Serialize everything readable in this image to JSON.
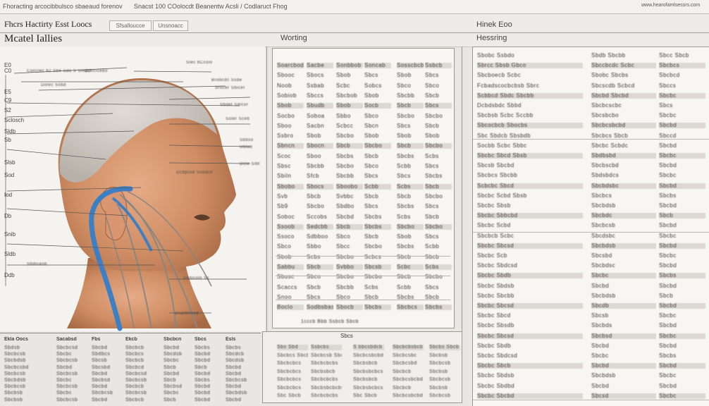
{
  "header": {
    "left_text": "Fhoracting arcocibbulsco sbaeaud forenov",
    "center_text": "Snacst 100 COolocdt Beanentw Acsli / Codlaruct Fhog",
    "right_text": "www.hearofamlsessrs.com"
  },
  "subheader": {
    "title": "Fhcrs Hactirty Esst  Loocs",
    "tabs": [
      "Sfsalloucce",
      "Unsnoacc"
    ],
    "right_label": "Hinek Eoo"
  },
  "diagram_panel": {
    "title": "Mcatel Iallies",
    "left_labels": [
      "E0",
      "C0",
      "E5",
      "C9",
      "S2",
      "Sclosch",
      "Sldb",
      "Sb",
      "Slsb",
      "Sod",
      "Iod",
      "Db",
      "Snib",
      "Sldb",
      "Ddb"
    ],
    "callouts": [
      "Conclec b2 Sbe Sdo S Sleacl",
      "Dolec Sobd",
      "Doncicebo",
      "Slec bCcoio",
      "Brobcdc Ssde",
      "Srocer Sbicer",
      "Sbdet Sdicor",
      "Soler Sceb",
      "Sbbso",
      "Ubteb",
      "Dcte Slbt",
      "Dcbpcse Scbdcn",
      "Sbdsiasb",
      "Dsdicolo Sc",
      "Dcalmccod"
    ]
  },
  "working_panel": {
    "title": "Worting",
    "columns": [
      [
        "Soarcbodbo",
        "Sbooc",
        "Noob",
        "Sobiob",
        "Sbob",
        "Socbo",
        "Sboo",
        "Ssbro",
        "Sbncn",
        "Scoc",
        "Sbsc",
        "Sbiln",
        "Sbobo",
        "Svb",
        "Sb9",
        "Soboc",
        "Ssoob",
        "Ssoco",
        "Sbco",
        "Sbob",
        "Sabbu",
        "Sbusc",
        "Scaccs",
        "Snoo",
        "Boclo"
      ],
      [
        "Sacbe",
        "Sbocs",
        "Ssbab",
        "Sbccs",
        "Sbudb",
        "Soboa",
        "Sacbn",
        "Sbob",
        "Sbocn",
        "Sboo",
        "Sbcbb",
        "Sfcb",
        "Sbocs",
        "Sbcb",
        "Sbcbo",
        "Sccobs",
        "Sedcbb",
        "Sdbboo",
        "Sbbo",
        "Scbs",
        "Sbcb",
        "Sbco",
        "Sbcb",
        "Sbcs",
        "Sodbsbaso"
      ],
      [
        "Sonbbob",
        "Sbob",
        "Scbc",
        "Sbcbob",
        "Sbob",
        "Sbbo",
        "Scbcc",
        "Sbcbo",
        "Sbcb",
        "Sbcbs",
        "Sbcbo",
        "Sbcbb",
        "Sboobo",
        "Svbbc",
        "Sbdbo",
        "Sbcbd",
        "Sbcb",
        "Sbco",
        "Sbcc",
        "Sbcbo",
        "Svbbo",
        "Sbcbo",
        "Sbcbb",
        "Sbco",
        "Sbocb"
      ],
      [
        "Soncab",
        "Sbcs",
        "Sobcs",
        "Sbob",
        "Socb",
        "Sbco",
        "Sbcn",
        "Sbob",
        "Sbcbo",
        "Sbcb",
        "Sbco",
        "Sbcs",
        "Scbb",
        "Sbcb",
        "Sbcs",
        "Sbcbs",
        "Sbcbs",
        "Sbcb",
        "Sbcbo",
        "Scbcs",
        "Sbcsb",
        "Sbcbo",
        "Scbs",
        "Sbcb",
        "Sbcbs"
      ],
      [
        "Sosscbcb",
        "Sbob",
        "Sbco",
        "Sbcbb",
        "Sbcb",
        "Sbcbo",
        "Sbcs",
        "Sbob",
        "Sbcb",
        "Sbcbs",
        "Scbb",
        "Sbcs",
        "Scbs",
        "Sbcb",
        "Sbcbs",
        "Scbs",
        "Sbcbo",
        "Sbob",
        "Sbcbs",
        "Sbcb",
        "Scbc",
        "Sbcb",
        "Scbb",
        "Sbcbs",
        "Sbcbcs"
      ],
      [
        "Ssbcb",
        "Sbcs",
        "Sbco",
        "Sbcb",
        "Sbcs",
        "Sbcbo",
        "Sbcb",
        "Sbob",
        "Sbcbo",
        "Scbs",
        "Sbcs",
        "Sbcbs",
        "Sbcb",
        "Sbcbo",
        "Sbcs",
        "Sbcb",
        "Sbcbo",
        "Sbcs",
        "Scbb",
        "Sbcb",
        "Scbs",
        "Sbcbo",
        "Sbcs",
        "Sbcb",
        "Sbcbs"
      ]
    ],
    "bottom_note": "1cccb Bbb Ssbcb Sbcb"
  },
  "hearing_panel": {
    "title": "Hessring",
    "column_a": [
      "Sbobc Ssbdo",
      "Sbrcc Sbsb Gbco",
      "Sbcboecb Scbc",
      "Fcbadscocbcbsb Sbrc",
      "Scbbcd Sbdc Sbcbb",
      "Dcbdsbdc Sbbd",
      "Sbcbsb Scbc Sccbb",
      "Sbcocbcb Sbocbs",
      "Sbc Sbdcb Sbsbdb",
      "Socbb Scbc Sbbc",
      "Sbcbc Sbcd Sbsb",
      "Sbcsb Sbcbd",
      "Sbcbcs Sbcbb",
      "Scbcbc Sbcd",
      "Sbcbc Scbd Sbsb",
      "Sbcbc Sbsb",
      "Sbcbc Sbbcbd",
      "Sbcbc Scbd",
      "Sbcbcb Scbc",
      "Sbcbc Sbcsd",
      "Sbcbc Scb",
      "Sbcbc Sbdcsd",
      "Sbcbc Sbdb",
      "Sbcbc Sbdsb",
      "Sbcbc Sbcbb",
      "Sbcbc Sbcsd",
      "Sbcbc Sbcd",
      "Sbcbc Sbsdb",
      "Sbcbc Sbcsd",
      "Sbcbc Sbdb",
      "Sbcbc Sbdcsd",
      "Sbcbc Sbcb",
      "Sbcbc Sbdsb",
      "Sbcbc Sbdbd",
      "Sbcbc Sbcbd"
    ],
    "column_b": [
      "Sbdb Sbcbb",
      "Sbccbcdc Scbc",
      "Sbobc Sbcbs",
      "Sbcscdb Scbcd",
      "Sbcbd Sbcbd",
      "Sbcbcscbc",
      "Sbcsbcbo",
      "Sbcbcsbcbd",
      "Sbcbcs Sbcb",
      "Sbcbc Scbdc",
      "Sbdbsbd",
      "Sbcbscbd",
      "Sbdsbdcs",
      "Sbcbdsbc",
      "Sbcbcs",
      "Sbcbdsb",
      "Sbcbdc",
      "Sbcbcsb",
      "Sbcdsbc",
      "Sbcbdsb",
      "Sbcsbd",
      "Sbcbdsc",
      "Sbcbc",
      "Sbcbd",
      "Sbcbdsb",
      "Sbcdb",
      "Sbcsb",
      "Sbcbds",
      "Sbcbsd",
      "Sbcbd",
      "Sbcbc",
      "Sbcbd",
      "Sbcbdsb",
      "Sbcbd",
      "Sbcsd"
    ],
    "column_c": [
      "Sbcc Sbcb",
      "Sbcbcs",
      "Sbcbcd",
      "Sbccs",
      "Sbcbc",
      "Sbcs",
      "Sbcbc",
      "Sbcbd",
      "Sbccd",
      "Sbcbd",
      "Sbcbc",
      "Sbcbd",
      "Sbcbc",
      "Sbcbd",
      "Sbcbs",
      "Sbcbd",
      "Sbcb",
      "Sbcbd",
      "Sbcbc",
      "Sbcbd",
      "Sbcbc",
      "Sbcbd",
      "Sbcbs",
      "Sbcbd",
      "Sbcb",
      "Sbcbd",
      "Sbcbc",
      "Sbcbd",
      "Sbcbc",
      "Sbcbd",
      "Sbcbs",
      "Sbcbd",
      "Sbcbc",
      "Sbcbd",
      "Sbcbc"
    ]
  },
  "bottom_left_table": {
    "headers": [
      "Ekla Oocs",
      "Sacabsd",
      "Fbs",
      "Ekcb",
      "Sbcbcn",
      "Sbcs",
      "Esls"
    ],
    "rows": [
      [
        "Sbdsb",
        "Sbcbcsd",
        "Sbcbd",
        "Sbcbcb",
        "Sbcbd",
        "Sbcbs",
        "Sbcbs"
      ],
      [
        "Sbcbcsb",
        "Sbcbc",
        "Sbdbcs",
        "Sbcbcs",
        "Sbcdsb",
        "Sbcbd",
        "Sbcdcb"
      ],
      [
        "Sbcbdsb",
        "Sbcbcsb",
        "Sbcsb",
        "Sbcbcb",
        "Sbcbc",
        "Sbcbd",
        "Sbcdsb"
      ],
      [
        "Sbcbcsbd",
        "Sbcbd",
        "Sbcsbd",
        "Sbcbcd",
        "Sbcb",
        "Sbcb",
        "Sbcbd"
      ],
      [
        "Sbcbcsb",
        "Sbcbcsb",
        "Sbcbd",
        "Sbcbcsd",
        "Sbcbd",
        "Sbcbd",
        "Sbcbd"
      ],
      [
        "Sbcbdsb",
        "Sbcbc",
        "Sbcbsd",
        "Sbcbcsb",
        "Sbcb",
        "Sbcbs",
        "Sbcbcsb"
      ],
      [
        "Sbcbcsb",
        "Sbcbcsb",
        "Sbcbd",
        "Sbcbcb",
        "Sbcbsd",
        "Sbcbd",
        "Sbcbd"
      ],
      [
        "Sbcbsb",
        "Sbcbc",
        "Sbcbcsb",
        "Sbcbcsb",
        "Sbcbc",
        "Sbcbd",
        "Sbcbdsb"
      ],
      [
        "Sbcbsb",
        "Sbcbcsb",
        "Sbcbd",
        "Sbcbcb",
        "Sbcb",
        "Sbcbd",
        "Sbcbd"
      ]
    ]
  },
  "bottom_mid_table": {
    "header": "Sbcs",
    "rows": [
      [
        "Sbs Sbd",
        "Ssbcbs",
        "S bbcsbdcb",
        "Sbcbcbsbcb",
        "Sbcbs Sbcb"
      ],
      [
        "Sbcbcs Sbcb",
        "Sbcbcsb Sbcbs",
        "Sbcbcsbcbd",
        "Sbcbcsbc",
        "Sbcbsb"
      ],
      [
        "Sbcbcbcs",
        "Sbcbcbcbs",
        "Sbcbsbcb",
        "Sbcbcsbd",
        "Sbcbcsb"
      ],
      [
        "Sbcbcbcs",
        "Sbcbsbcb",
        "Sbcbsbcbcs",
        "Sbcbcb",
        "Sbcbsb"
      ],
      [
        "Sbcbcbcs",
        "Sbcbcbcbs",
        "Sbcbsbcb",
        "Sbcbcsbcbd",
        "Sbcbcsb"
      ],
      [
        "Sbcbcbcs",
        "Sbcbsbcbcbs",
        "Sbcbsbcbcs",
        "Sbcbcb",
        "Sbcbsb"
      ],
      [
        "Sbc Sbcb",
        "Sbcbcbcbs",
        "Sbc Sbcb",
        "Sbcbcsbcbd",
        "Sbcbcsb"
      ]
    ]
  }
}
